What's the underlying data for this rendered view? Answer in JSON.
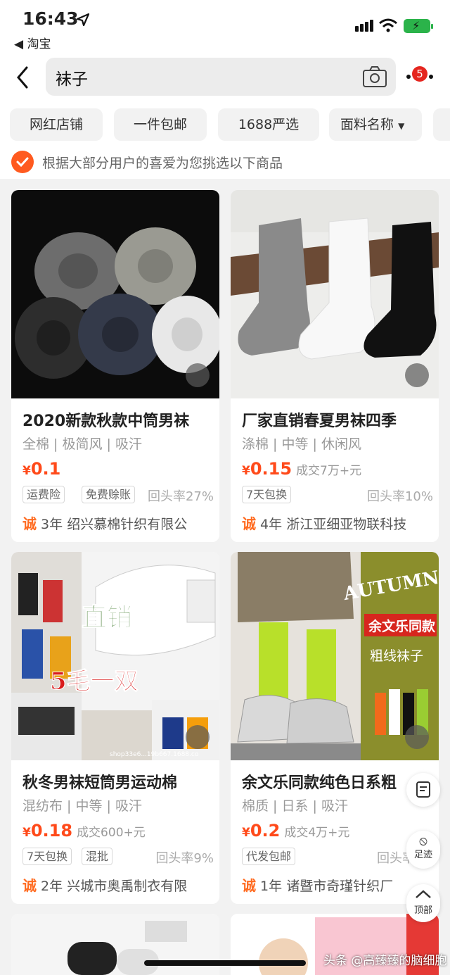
{
  "status": {
    "time": "16:43",
    "back_app": "◀ 淘宝"
  },
  "search": {
    "query": "袜子",
    "cart_count": "5"
  },
  "filters": [
    "网红店铺",
    "一件包邮",
    "1688严选",
    "面料名称"
  ],
  "hint": "根据大部分用户的喜爱为您挑选以下商品",
  "products": [
    {
      "title": "2020新款秋款中筒男袜",
      "tags": "全棉 | 极简风 | 吸汗",
      "yen": "¥",
      "price": "0.1",
      "sold": "",
      "badges": [
        "运费险",
        "免费赊账"
      ],
      "repeat": "回头率27%",
      "cheng": "诚",
      "years": "3年",
      "shop": "绍兴慕棉针织有限公"
    },
    {
      "title": "厂家直销春夏男袜四季",
      "tags": "涤棉 | 中等 | 休闲风",
      "yen": "¥",
      "price": "0.15",
      "sold": "成交7万+元",
      "badges": [
        "7天包换"
      ],
      "repeat": "回头率10%",
      "cheng": "诚",
      "years": "4年",
      "shop": "浙江亚细亚物联科技"
    },
    {
      "title": "秋冬男袜短筒男运动棉",
      "tags": "混纺布 | 中等 | 吸汗",
      "yen": "¥",
      "price": "0.18",
      "sold": "成交600+元",
      "badges": [
        "7天包换",
        "混批"
      ],
      "repeat": "回头率9%",
      "cheng": "诚",
      "years": "2年",
      "shop": "兴城市奥禹制衣有限"
    },
    {
      "title": "余文乐同款纯色日系粗",
      "tags": "棉质 | 日系 | 吸汗",
      "yen": "¥",
      "price": "0.2",
      "sold": "成交4万+元",
      "badges": [
        "代发包邮"
      ],
      "repeat": "回头率",
      "cheng": "诚",
      "years": "1年",
      "shop": "诸暨市奇瑾针织厂"
    }
  ],
  "image_text": {
    "p3_line1": "直销",
    "p3_line2": "5毛一双",
    "p3_url": "shop33e6...19b667.1688.co",
    "p4_autumn": "AUTUMN",
    "p4_banner": "余文乐同款",
    "p4_sub": "粗线袜子"
  },
  "side_buttons": {
    "footprint": "足迹",
    "top": "顶部"
  },
  "watermark": "头条 @高臻臻的脑细胞",
  "colors": {
    "accent": "#ff4a1a",
    "badge": "#e5261f",
    "battery": "#2bb34a"
  }
}
